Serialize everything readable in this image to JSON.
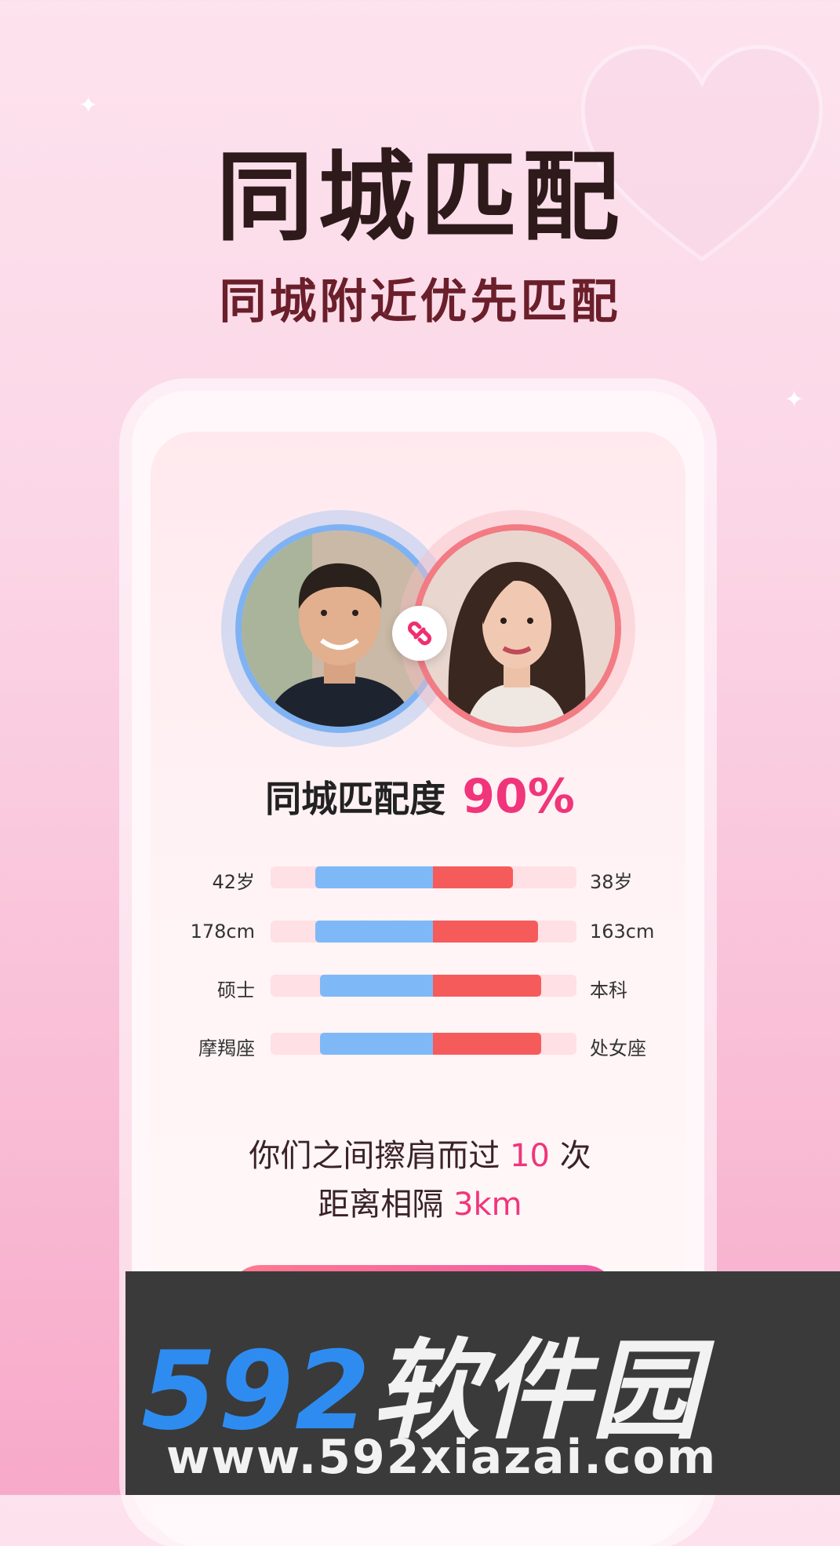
{
  "header": {
    "title": "同城匹配",
    "subtitle": "同城附近优先匹配"
  },
  "match": {
    "label": "同城匹配度",
    "value": "90%"
  },
  "stats": [
    {
      "left": "42岁",
      "right": "38岁",
      "male_fraction": 0.47,
      "female_fraction": 0.32
    },
    {
      "left": "178cm",
      "right": "163cm",
      "male_fraction": 0.47,
      "female_fraction": 0.42
    },
    {
      "left": "硕士",
      "right": "本科",
      "male_fraction": 0.45,
      "female_fraction": 0.43
    },
    {
      "left": "摩羯座",
      "right": "处女座",
      "male_fraction": 0.45,
      "female_fraction": 0.43
    }
  ],
  "encounter": {
    "prefix": "你们之间擦肩而过",
    "count": "10",
    "suffix": "次",
    "distance_prefix": "距离相隔",
    "distance": "3km"
  },
  "watermark": {
    "number": "592",
    "brand": "软件园",
    "url": "www.592xiazai.com"
  },
  "colors": {
    "accent": "#f0357a",
    "male": "#7fb8f7",
    "female": "#f65b5b"
  }
}
